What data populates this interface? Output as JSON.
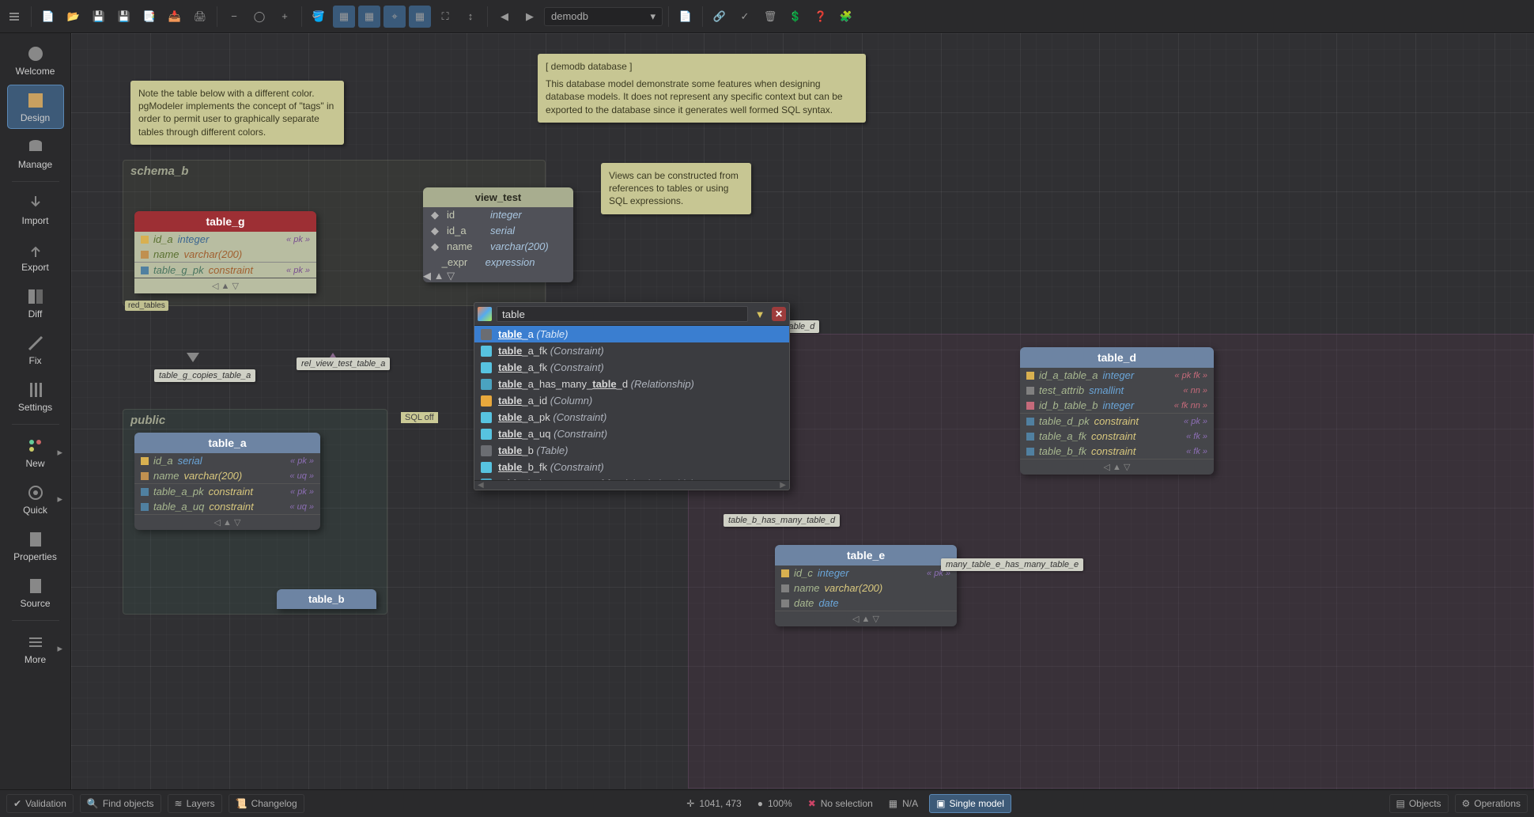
{
  "toolbar": {
    "model_selector": "demodb"
  },
  "sidebar": {
    "welcome": "Welcome",
    "design": "Design",
    "manage": "Manage",
    "import": "Import",
    "export": "Export",
    "diff": "Diff",
    "fix": "Fix",
    "settings": "Settings",
    "new": "New",
    "quick": "Quick",
    "properties": "Properties",
    "source": "Source",
    "more": "More"
  },
  "notes": {
    "tags": "Note the table below with a different color. pgModeler implements the concept of \"tags\" in order to permit user to graphically separate tables through different colors.",
    "db_title": "[ demodb database ]",
    "db_body": "This database model demonstrate some features when designing database models. It does not represent any specific context but can be exported to the database since it generates well formed SQL syntax.",
    "views": "Views can be constructed from references to tables or using SQL expressions."
  },
  "schema_b": {
    "label": "schema_b"
  },
  "public": {
    "label": "public"
  },
  "tables": {
    "g": {
      "name": "table_g",
      "cols": [
        {
          "n": "id_a",
          "t": "integer",
          "tag": "« pk »"
        },
        {
          "n": "name",
          "t": "varchar(200)",
          "tag": ""
        },
        {
          "n": "table_g_pk",
          "t": "constraint",
          "tag": "« pk »"
        }
      ],
      "tag": "red_tables"
    },
    "a": {
      "name": "table_a",
      "cols": [
        {
          "n": "id_a",
          "t": "serial",
          "tag": "« pk »"
        },
        {
          "n": "name",
          "t": "varchar(200)",
          "tag": "« uq »"
        },
        {
          "n": "table_a_pk",
          "t": "constraint",
          "tag": "« pk »"
        },
        {
          "n": "table_a_uq",
          "t": "constraint",
          "tag": "« uq »"
        }
      ]
    },
    "d": {
      "name": "table_d",
      "cols": [
        {
          "n": "id_a_table_a",
          "t": "integer",
          "tag": "« pk fk »"
        },
        {
          "n": "test_attrib",
          "t": "smallint",
          "tag": "« nn »"
        },
        {
          "n": "id_b_table_b",
          "t": "integer",
          "tag": "« fk nn »"
        },
        {
          "n": "table_d_pk",
          "t": "constraint",
          "tag": "« pk »"
        },
        {
          "n": "table_a_fk",
          "t": "constraint",
          "tag": "« fk »"
        },
        {
          "n": "table_b_fk",
          "t": "constraint",
          "tag": "« fk »"
        }
      ]
    },
    "e": {
      "name": "table_e",
      "cols": [
        {
          "n": "id_c",
          "t": "integer",
          "tag": "« pk »"
        },
        {
          "n": "name",
          "t": "varchar(200)",
          "tag": ""
        },
        {
          "n": "date",
          "t": "date",
          "tag": ""
        }
      ]
    },
    "b": {
      "name": "table_b"
    }
  },
  "view": {
    "name": "view_test",
    "cols": [
      {
        "n": "id",
        "t": "integer"
      },
      {
        "n": "id_a",
        "t": "serial"
      },
      {
        "n": "name",
        "t": "varchar(200)"
      },
      {
        "n": "_expr",
        "t": "expression"
      }
    ]
  },
  "rels": {
    "g_copies_a": "table_g_copies_table_a",
    "view_a": "rel_view_test_table_a",
    "view_d": "rel_view_test_table_d",
    "b_many_d": "table_b_has_many_table_d",
    "e_many_e": "many_table_e_has_many_table_e"
  },
  "sqloff": "SQL off",
  "finder": {
    "query": "table",
    "items": [
      {
        "pre": "table",
        "suf": "_a",
        "type": "(Table)",
        "ico": "#6b6d72",
        "sel": true
      },
      {
        "pre": "table",
        "suf": "_a_fk",
        "type": "(Constraint)",
        "ico": "#57c3e0"
      },
      {
        "pre": "table",
        "suf": "_a_fk",
        "type": "(Constraint)",
        "ico": "#57c3e0"
      },
      {
        "pre": "table",
        "suf": "_a_has_many_",
        "mid": "table",
        "suf2": "_d",
        "type": "(Relationship)",
        "ico": "#4aa3c0"
      },
      {
        "pre": "table",
        "suf": "_a_id",
        "type": "(Column)",
        "ico": "#e8a83c"
      },
      {
        "pre": "table",
        "suf": "_a_pk",
        "type": "(Constraint)",
        "ico": "#57c3e0"
      },
      {
        "pre": "table",
        "suf": "_a_uq",
        "type": "(Constraint)",
        "ico": "#57c3e0"
      },
      {
        "pre": "table",
        "suf": "_b",
        "type": "(Table)",
        "ico": "#6b6d72"
      },
      {
        "pre": "table",
        "suf": "_b_fk",
        "type": "(Constraint)",
        "ico": "#57c3e0"
      },
      {
        "pre": "table",
        "suf": "_b_has_many_",
        "mid": "table",
        "suf2": "_d",
        "type": "(Relationship)",
        "ico": "#4aa3c0"
      }
    ]
  },
  "status": {
    "validation": "Validation",
    "find": "Find objects",
    "layers": "Layers",
    "changelog": "Changelog",
    "coords": "1041, 473",
    "zoom": "100%",
    "selection": "No selection",
    "na": "N/A",
    "single": "Single model",
    "objects": "Objects",
    "operations": "Operations"
  }
}
